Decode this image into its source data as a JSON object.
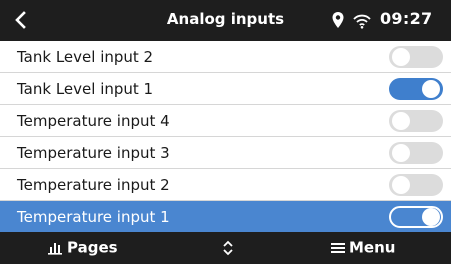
{
  "header": {
    "title": "Analog inputs",
    "time": "09:27",
    "back_icon": "chevron-left-icon",
    "location_icon": "location-pin-icon",
    "wifi_icon": "wifi-icon"
  },
  "inputs": [
    {
      "label": "Tank Level input 2",
      "enabled": false,
      "selected": false
    },
    {
      "label": "Tank Level input 1",
      "enabled": true,
      "selected": false
    },
    {
      "label": "Temperature input 4",
      "enabled": false,
      "selected": false
    },
    {
      "label": "Temperature input 3",
      "enabled": false,
      "selected": false
    },
    {
      "label": "Temperature input 2",
      "enabled": false,
      "selected": false
    },
    {
      "label": "Temperature input 1",
      "enabled": true,
      "selected": true
    }
  ],
  "footer": {
    "pages_label": "Pages",
    "menu_label": "Menu",
    "pages_icon": "bar-chart-icon",
    "updown_icon": "up-down-arrows-icon",
    "menu_icon": "hamburger-menu-icon"
  },
  "colors": {
    "bar_background": "#1e1e1e",
    "selection": "#4a86d0",
    "toggle_on": "#3f7fcd",
    "toggle_off": "#dcdcdc"
  }
}
